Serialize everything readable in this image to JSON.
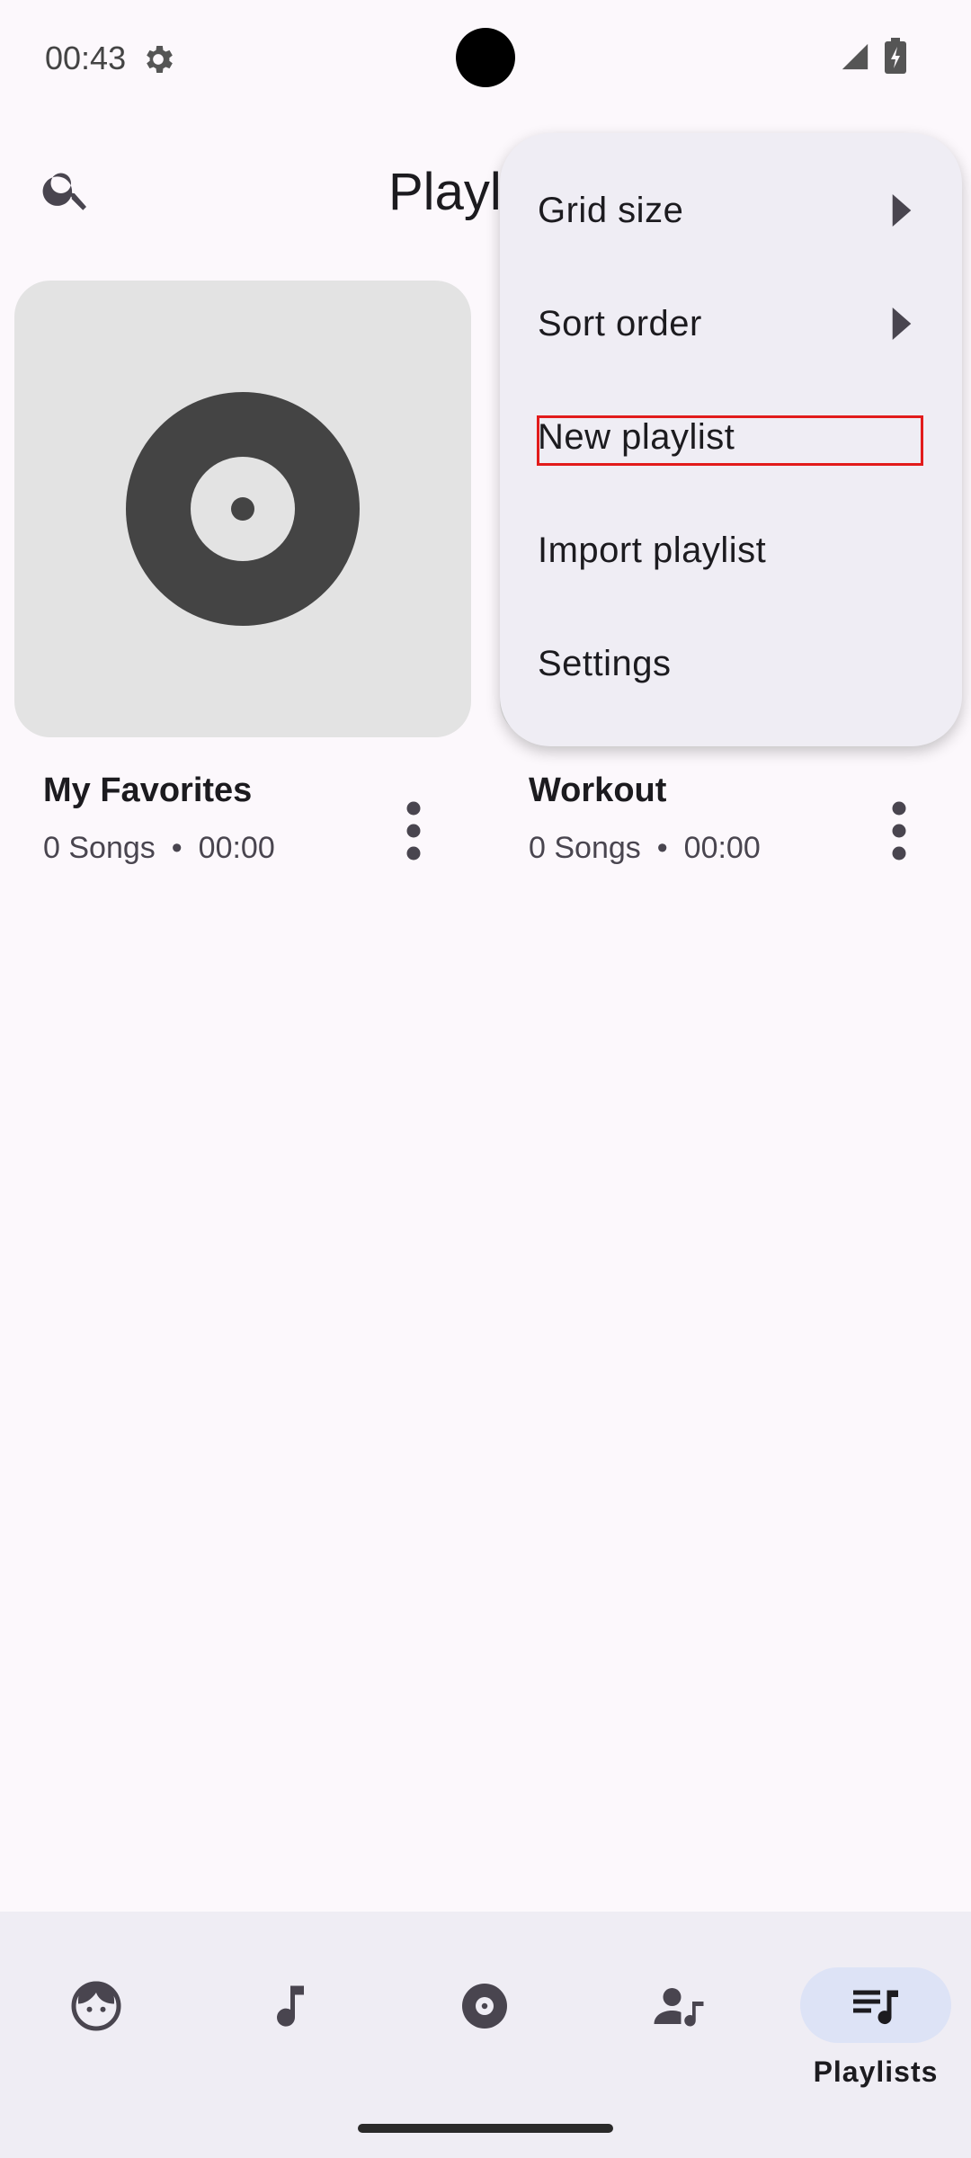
{
  "status_bar": {
    "time": "00:43"
  },
  "header": {
    "title": "Playlists"
  },
  "playlists": [
    {
      "name": "My Favorites",
      "songs": "0 Songs",
      "separator": "•",
      "duration": "00:00"
    },
    {
      "name": "Workout",
      "songs": "0 Songs",
      "separator": "•",
      "duration": "00:00"
    }
  ],
  "overflow_menu": {
    "items": [
      {
        "label": "Grid size",
        "has_submenu": true
      },
      {
        "label": "Sort order",
        "has_submenu": true
      },
      {
        "label": "New playlist",
        "has_submenu": false,
        "highlighted": true
      },
      {
        "label": "Import playlist",
        "has_submenu": false
      },
      {
        "label": "Settings",
        "has_submenu": false
      }
    ]
  },
  "bottom_nav": {
    "items": [
      {
        "icon": "artist-face-icon",
        "label": ""
      },
      {
        "icon": "music-note-icon",
        "label": ""
      },
      {
        "icon": "album-disc-icon",
        "label": ""
      },
      {
        "icon": "user-music-icon",
        "label": ""
      },
      {
        "icon": "playlist-icon",
        "label": "Playlists",
        "selected": true
      }
    ]
  },
  "colors": {
    "background": "#fcf8fc",
    "menu_background": "#efedf4",
    "nav_background": "#efedf4",
    "nav_selected_pill": "#dde3f6",
    "album_art_bg": "#e3e3e3",
    "disc": "#444444",
    "highlight": "#e21b1b"
  }
}
